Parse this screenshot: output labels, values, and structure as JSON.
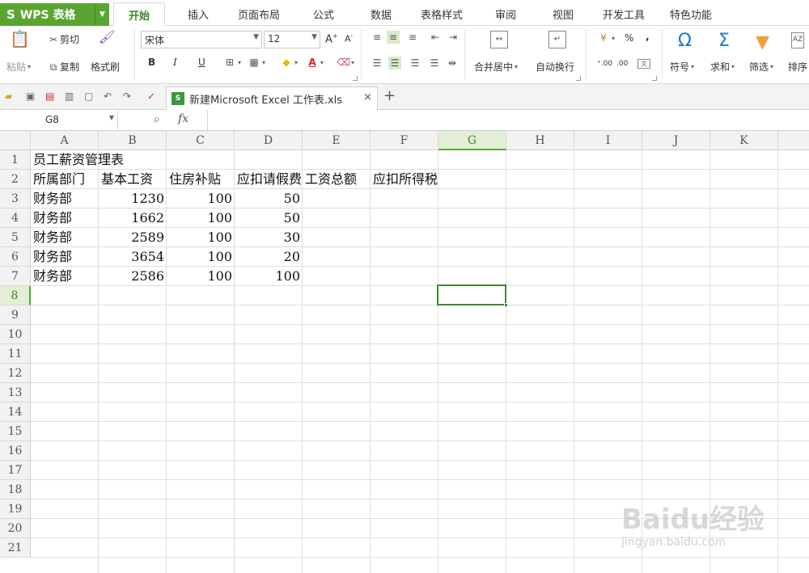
{
  "app": {
    "name": "WPS 表格",
    "logo": "S"
  },
  "menu_tabs": [
    "开始",
    "插入",
    "页面布局",
    "公式",
    "数据",
    "表格样式",
    "审阅",
    "视图",
    "开发工具",
    "特色功能"
  ],
  "active_menu_tab": "开始",
  "ribbon": {
    "paste": "粘贴",
    "cut": "剪切",
    "copy": "复制",
    "format_painter": "格式刷",
    "font_name": "宋体",
    "font_size": "12",
    "bold": "B",
    "italic": "I",
    "underline": "U",
    "merge_center": "合并居中",
    "wrap_text": "自动换行",
    "percent": "%",
    "comma": ",",
    "dec_inc": ".00\n.0",
    "symbol": "符号",
    "sum": "求和",
    "filter": "筛选",
    "sort": "排序"
  },
  "document_tab": {
    "name": "新建Microsoft Excel 工作表.xls",
    "close": "×"
  },
  "formula_bar": {
    "name_box": "G8",
    "fx": "fx",
    "content": ""
  },
  "columns": [
    "A",
    "B",
    "C",
    "D",
    "E",
    "F",
    "G",
    "H",
    "I",
    "J",
    "K"
  ],
  "active_column": "G",
  "rows": [
    "1",
    "2",
    "3",
    "4",
    "5",
    "6",
    "7",
    "8",
    "9",
    "10",
    "11",
    "12",
    "13",
    "14",
    "15",
    "16",
    "17",
    "18",
    "19",
    "20",
    "21"
  ],
  "active_row": "8",
  "sheet": {
    "title": "员工薪资管理表",
    "headers": [
      "所属部门",
      "基本工资",
      "住房补贴",
      "应扣请假费",
      "工资总额",
      "应扣所得税"
    ],
    "data": [
      [
        "财务部",
        "1230",
        "100",
        "50"
      ],
      [
        "财务部",
        "1662",
        "100",
        "50"
      ],
      [
        "财务部",
        "2589",
        "100",
        "30"
      ],
      [
        "财务部",
        "3654",
        "100",
        "20"
      ],
      [
        "财务部",
        "2586",
        "100",
        "100"
      ]
    ]
  },
  "watermark": {
    "brand": "Baidu经验",
    "url": "jingyan.baidu.com"
  }
}
